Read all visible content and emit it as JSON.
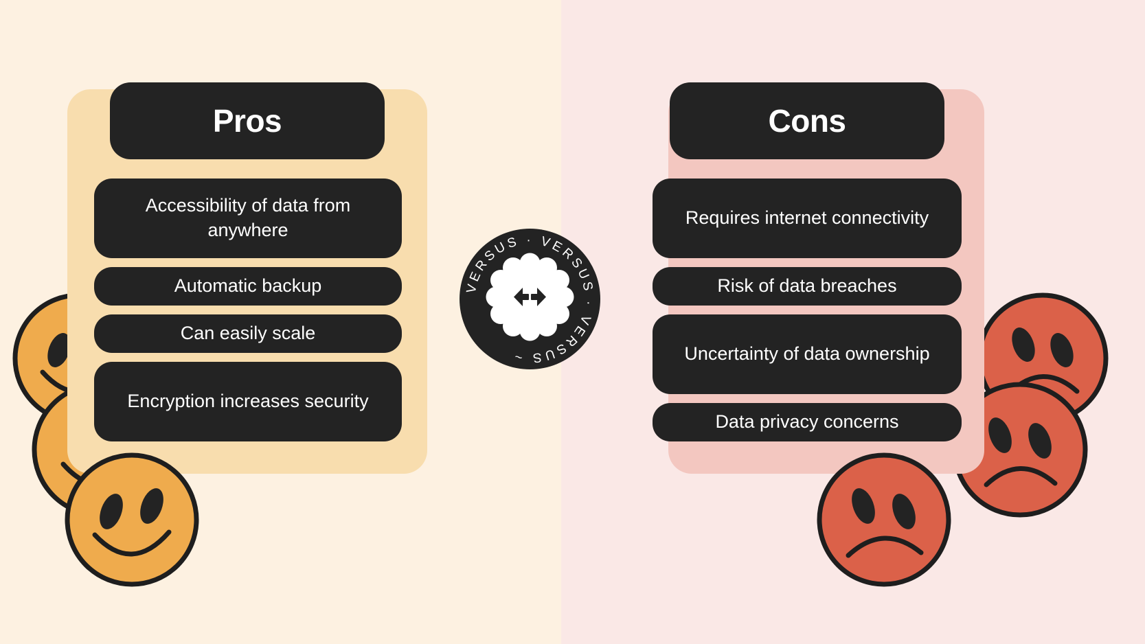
{
  "theme": {
    "bg_left": "#FDF1E1",
    "bg_right": "#FAE8E6",
    "panel_left": "#F8DDAE",
    "panel_right": "#F3C7C0",
    "pill_dark": "#232323",
    "pill_text": "#FFFFFF",
    "happy_face": "#EFAB4D",
    "sad_face": "#DB6149",
    "outline": "#1E1E1E"
  },
  "left": {
    "title": "Pros",
    "items": [
      "Accessibility of data from anywhere",
      "Automatic backup",
      "Can easily scale",
      "Encryption increases security"
    ],
    "mascot": "happy-face"
  },
  "right": {
    "title": "Cons",
    "items": [
      "Requires internet connectivity",
      "Risk of data breaches",
      "Uncertainty of data ownership",
      "Data privacy concerns"
    ],
    "mascot": "sad-face"
  },
  "badge": {
    "ring_text": "VERSUS · VERSUS · VERSUS ~ ",
    "word": "VERSUS",
    "separator": "·",
    "tilde": "~",
    "center_icon": "left-right-arrow-icon"
  }
}
